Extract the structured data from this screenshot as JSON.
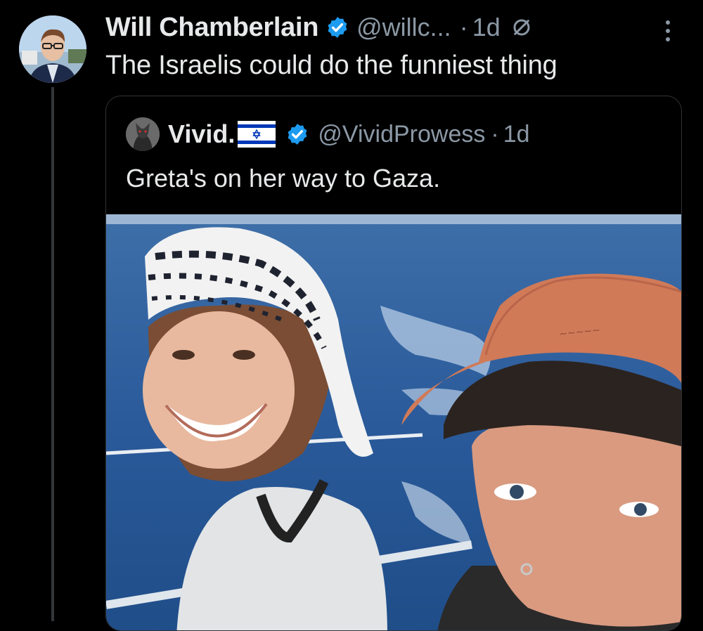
{
  "tweet": {
    "author_name": "Will Chamberlain",
    "author_handle": "@willc...",
    "separator": "·",
    "time": "1d",
    "text": "The Israelis could do the funniest thing"
  },
  "quoted_tweet": {
    "author_name": "Vivid.",
    "author_handle": "@VividProwess",
    "separator": "·",
    "time": "1d",
    "text": "Greta's on her way to Gaza."
  },
  "icons": {
    "verified": "verified-badge-icon",
    "edit": "edited-icon",
    "more": "more-options-icon",
    "flag": "israel-flag-icon"
  },
  "colors": {
    "background": "#000000",
    "primary_text": "#e7e9ea",
    "secondary_text": "#8b98a5",
    "verified_blue": "#1d9bf0",
    "border": "#2f3336"
  }
}
